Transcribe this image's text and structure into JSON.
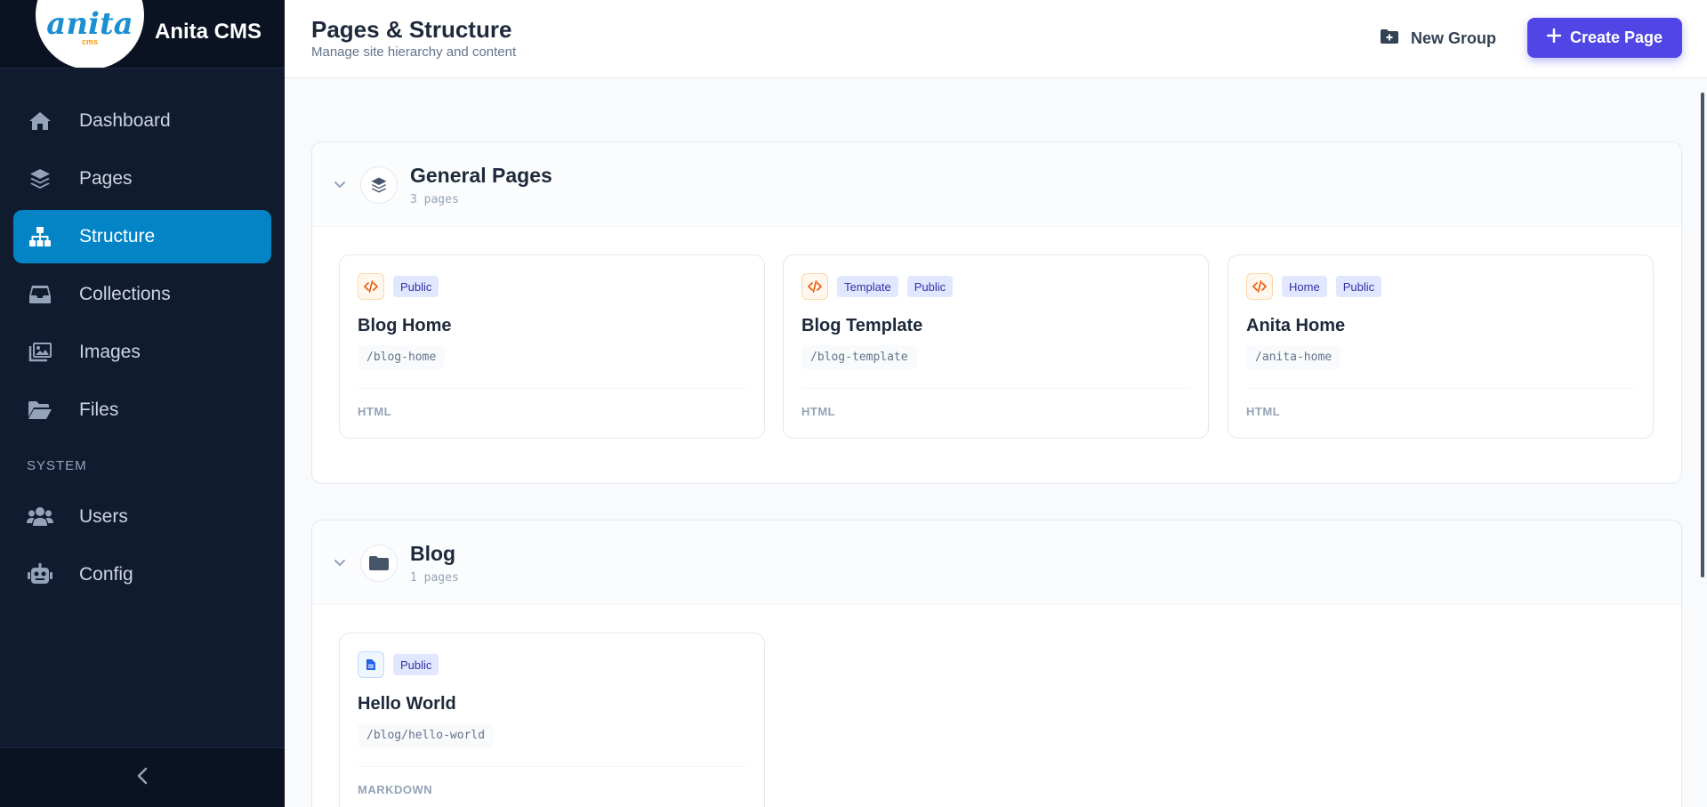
{
  "app": {
    "name": "Anita CMS",
    "logo_text": "anita",
    "logo_sub": "cms"
  },
  "sidebar": {
    "items": [
      {
        "label": "Dashboard",
        "icon": "home-icon"
      },
      {
        "label": "Pages",
        "icon": "layers-icon"
      },
      {
        "label": "Structure",
        "icon": "sitemap-icon",
        "active": true
      },
      {
        "label": "Collections",
        "icon": "inbox-icon"
      },
      {
        "label": "Images",
        "icon": "images-icon"
      },
      {
        "label": "Files",
        "icon": "folder-open-icon"
      }
    ],
    "section_label": "SYSTEM",
    "system_items": [
      {
        "label": "Users",
        "icon": "users-icon"
      },
      {
        "label": "Config",
        "icon": "robot-icon"
      }
    ],
    "collapse_icon": "chevron-left-icon"
  },
  "header": {
    "title": "Pages & Structure",
    "subtitle": "Manage site hierarchy and content",
    "new_group_label": "New Group",
    "create_page_label": "Create Page"
  },
  "groups": [
    {
      "name": "General Pages",
      "count": "3 pages",
      "icon": "layers-icon",
      "pages": [
        {
          "title": "Blog Home",
          "path": "/blog-home",
          "format": "HTML",
          "type_icon": "code-icon",
          "tags": [
            "Public"
          ]
        },
        {
          "title": "Blog Template",
          "path": "/blog-template",
          "format": "HTML",
          "type_icon": "code-icon",
          "tags": [
            "Template",
            "Public"
          ]
        },
        {
          "title": "Anita Home",
          "path": "/anita-home",
          "format": "HTML",
          "type_icon": "code-icon",
          "tags": [
            "Home",
            "Public"
          ]
        }
      ]
    },
    {
      "name": "Blog",
      "count": "1 pages",
      "icon": "folder-icon",
      "pages": [
        {
          "title": "Hello World",
          "path": "/blog/hello-world",
          "format": "MARKDOWN",
          "type_icon": "document-icon",
          "tags": [
            "Public"
          ]
        }
      ]
    }
  ],
  "colors": {
    "sidebar_bg": "#111b30",
    "active_nav": "#0284c7",
    "primary_button": "#4f46e5",
    "tag_bg": "#e0e7ff",
    "tag_text": "#3730a3",
    "code_icon": "#ea580c",
    "doc_icon": "#2563eb"
  }
}
